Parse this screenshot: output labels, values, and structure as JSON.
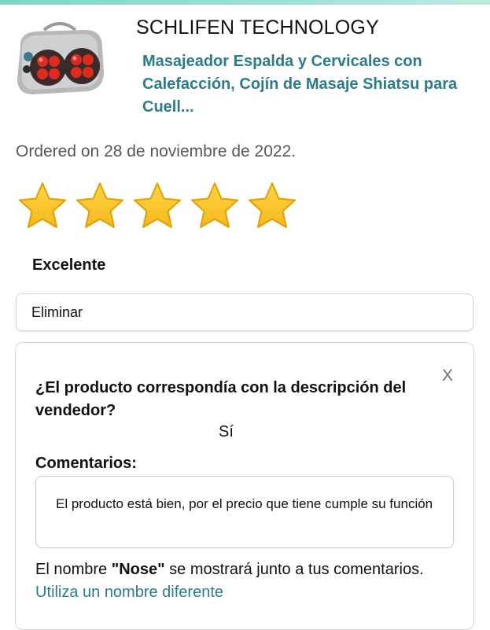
{
  "product": {
    "brand": "SCHLIFEN TECHNOLOGY",
    "title": "Masajeador Espalda y Cervicales con Calefacción, Cojín de Masaje Shiatsu para Cuell...",
    "image_icon": "massage-pillow-icon"
  },
  "order": {
    "ordered_text": "Ordered on 28 de noviembre de 2022."
  },
  "rating": {
    "stars": 5,
    "max_stars": 5,
    "label": "Excelente",
    "star_color": "#f5b81c"
  },
  "delete_button": {
    "label": "Eliminar"
  },
  "review_card": {
    "close_label": "X",
    "question": "¿El producto correspondía con la descripción del vendedor?",
    "answer": "Sí",
    "comments_label": "Comentarios:",
    "comment_text": "El producto está bien, por el precio que tiene cumple su función",
    "name_note_prefix": "El nombre ",
    "name_value": "\"Nose\"",
    "name_note_suffix": " se mostrará junto a tus comentarios. ",
    "change_name_link": "Utiliza un nombre diferente"
  },
  "colors": {
    "link": "#2b7c8a",
    "accent_bar": "#7fd6c6"
  }
}
